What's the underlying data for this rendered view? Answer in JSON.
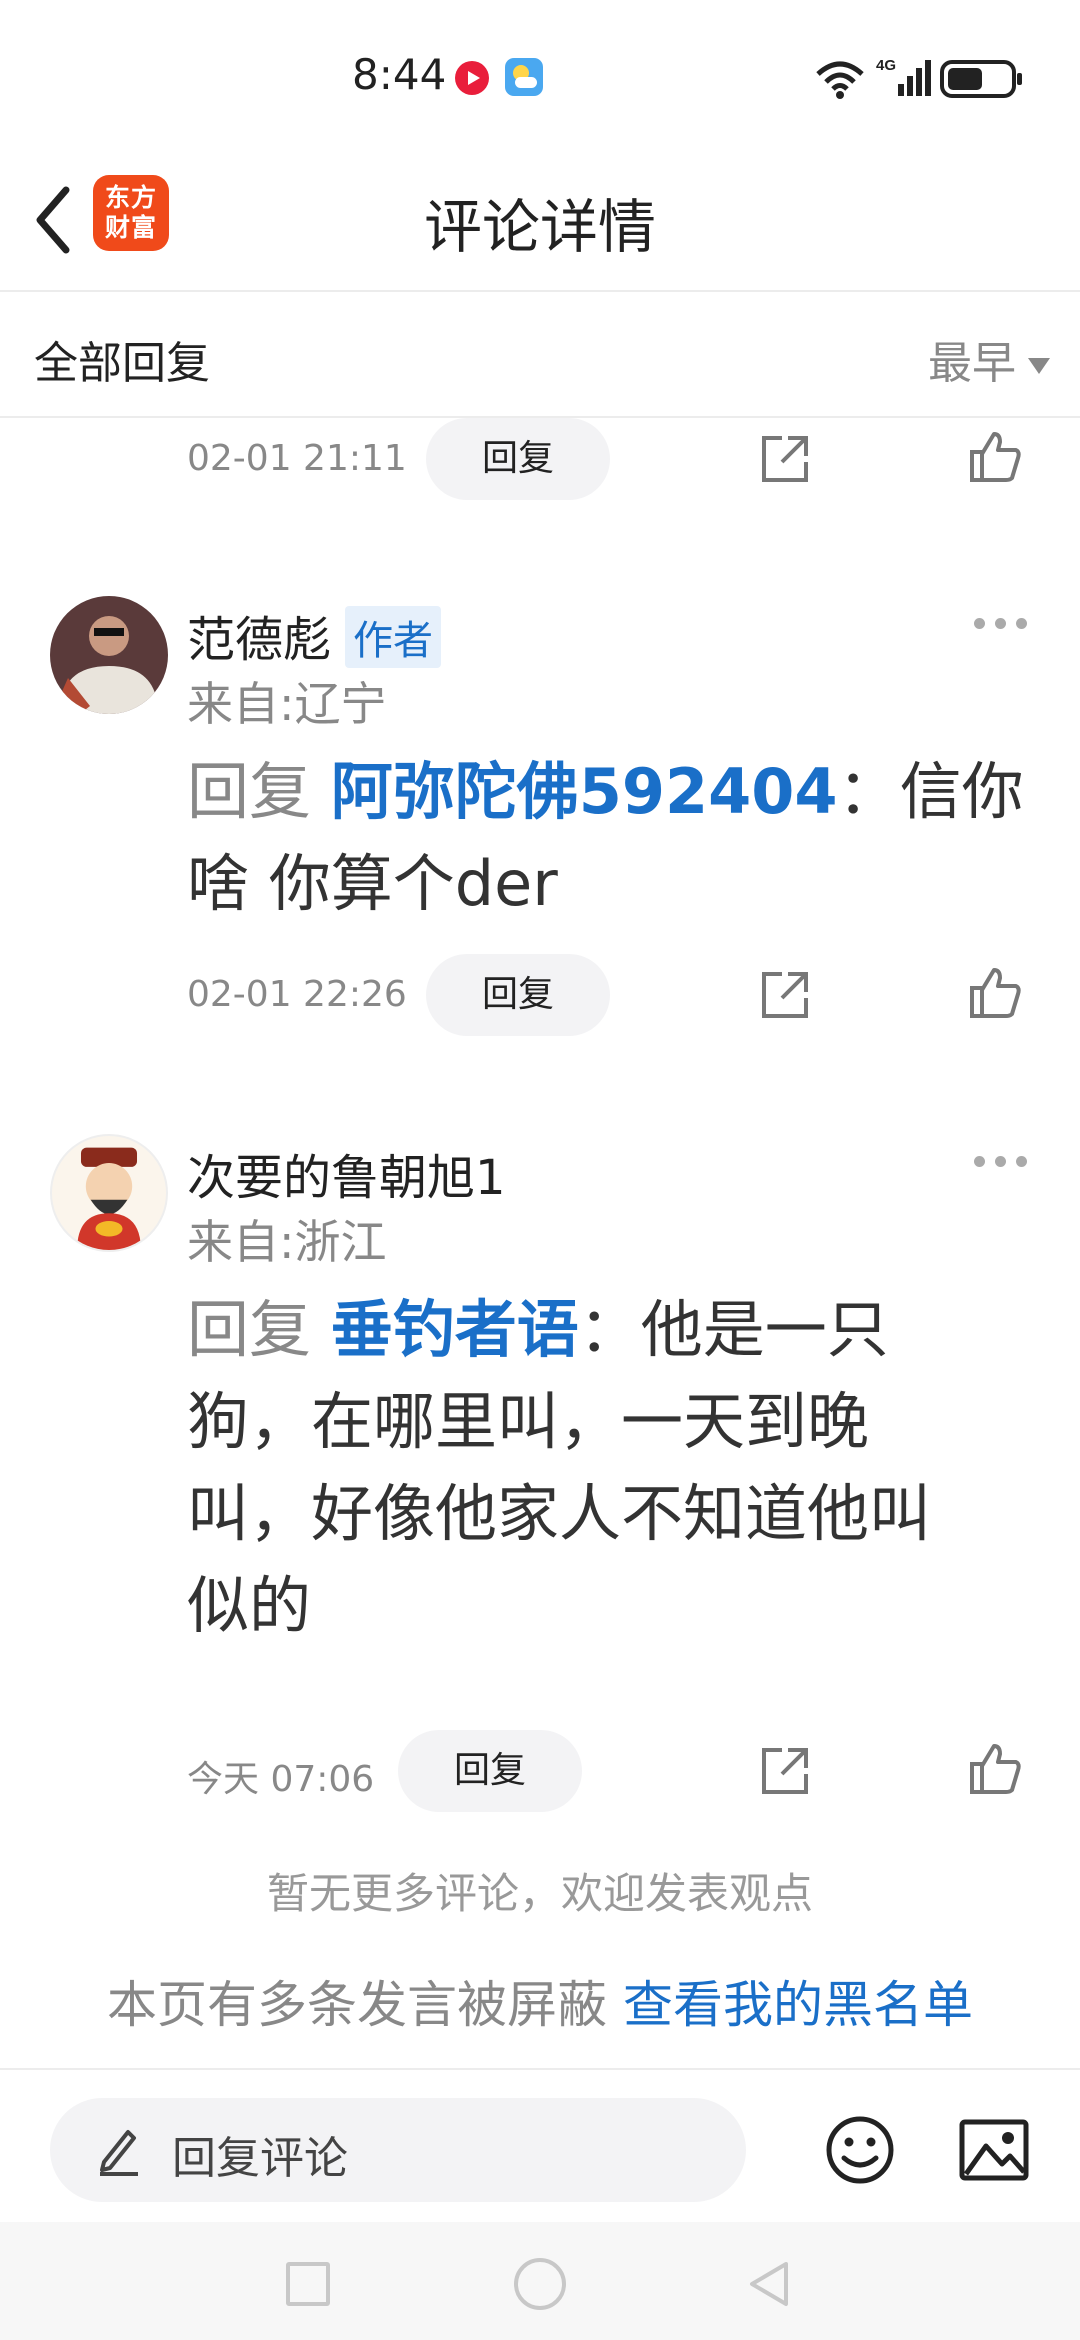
{
  "status_bar": {
    "time": "8:44",
    "network": "4G"
  },
  "header": {
    "title": "评论详情",
    "app_logo": "东方\n财富"
  },
  "filter": {
    "label": "全部回复",
    "sort": "最早"
  },
  "prev_comment": {
    "timestamp": "02-01 21:11",
    "reply_label": "回复"
  },
  "comments": [
    {
      "user": "范德彪",
      "badge": "作者",
      "location": "来自:辽宁",
      "reply_prefix": "回复",
      "reply_target": "阿弥陀佛592404",
      "text": "：信你啥 你算个der",
      "timestamp": "02-01 22:26",
      "reply_label": "回复"
    },
    {
      "user": "次要的鲁朝旭1",
      "location": "来自:浙江",
      "reply_prefix": "回复",
      "reply_target": "垂钓者语",
      "text": "：他是一只狗，在哪里叫，一天到晚叫，好像他家人不知道他叫似的",
      "timestamp": "今天 07:06",
      "reply_label": "回复"
    }
  ],
  "footer": {
    "end_note": "暂无更多评论，欢迎发表观点",
    "blocked_text": "本页有多条发言被屏蔽",
    "blocked_link": "查看我的黑名单"
  },
  "input": {
    "placeholder": "回复评论"
  },
  "colors": {
    "accent": "#1a6fc8",
    "brand": "#f04a1a"
  }
}
